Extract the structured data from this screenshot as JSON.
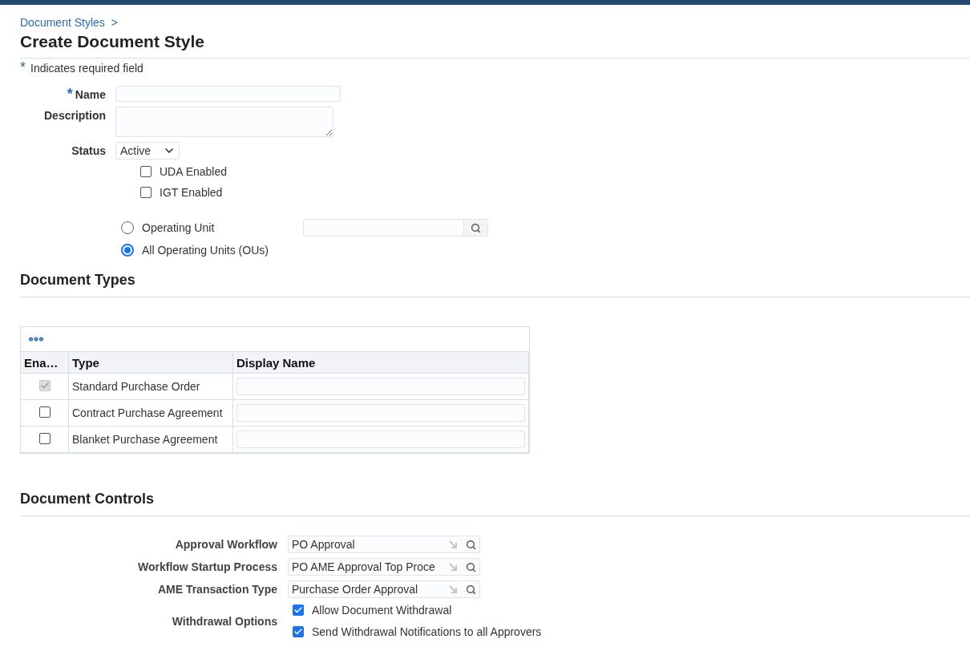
{
  "breadcrumb": {
    "link": "Document Styles",
    "separator": ">"
  },
  "title": "Create Document Style",
  "required_note": {
    "mark": "*",
    "text": "Indicates required field"
  },
  "fields": [
    {
      "kind": "text",
      "label": "Name",
      "mark": "*"
    },
    {
      "kind": "textarea",
      "label": "Description"
    },
    {
      "kind": "select",
      "label": "Status",
      "value": "Active"
    }
  ],
  "flags": [
    {
      "label": "UDA Enabled",
      "checked": false
    },
    {
      "label": "IGT Enabled",
      "checked": false
    }
  ],
  "scope": [
    {
      "kind": "lookup",
      "label": "Operating Unit",
      "selected": false
    },
    {
      "kind": "plain",
      "label": "All Operating Units (OUs)",
      "selected": true
    }
  ],
  "document_types": {
    "heading": "Document Types",
    "columns": [
      "Ena…",
      "Type",
      "Display Name"
    ],
    "rows": [
      {
        "type": "Standard Purchase Order",
        "enabled": true,
        "disabled": true
      },
      {
        "type": "Contract Purchase Agreement",
        "enabled": false,
        "disabled": false
      },
      {
        "type": "Blanket Purchase Agreement",
        "enabled": false,
        "disabled": false
      }
    ]
  },
  "document_controls": {
    "heading": "Document Controls",
    "lookups": [
      {
        "label": "Approval Workflow",
        "value": "PO Approval"
      },
      {
        "label": "Workflow Startup Process",
        "value": "PO AME Approval Top Proce"
      },
      {
        "label": "AME Transaction Type",
        "value": "Purchase Order Approval"
      }
    ],
    "withdrawal": {
      "label": "Withdrawal Options",
      "options": [
        {
          "label": "Allow Document Withdrawal",
          "checked": true
        },
        {
          "label": "Send Withdrawal Notifications to all Approvers",
          "checked": true
        }
      ]
    }
  }
}
